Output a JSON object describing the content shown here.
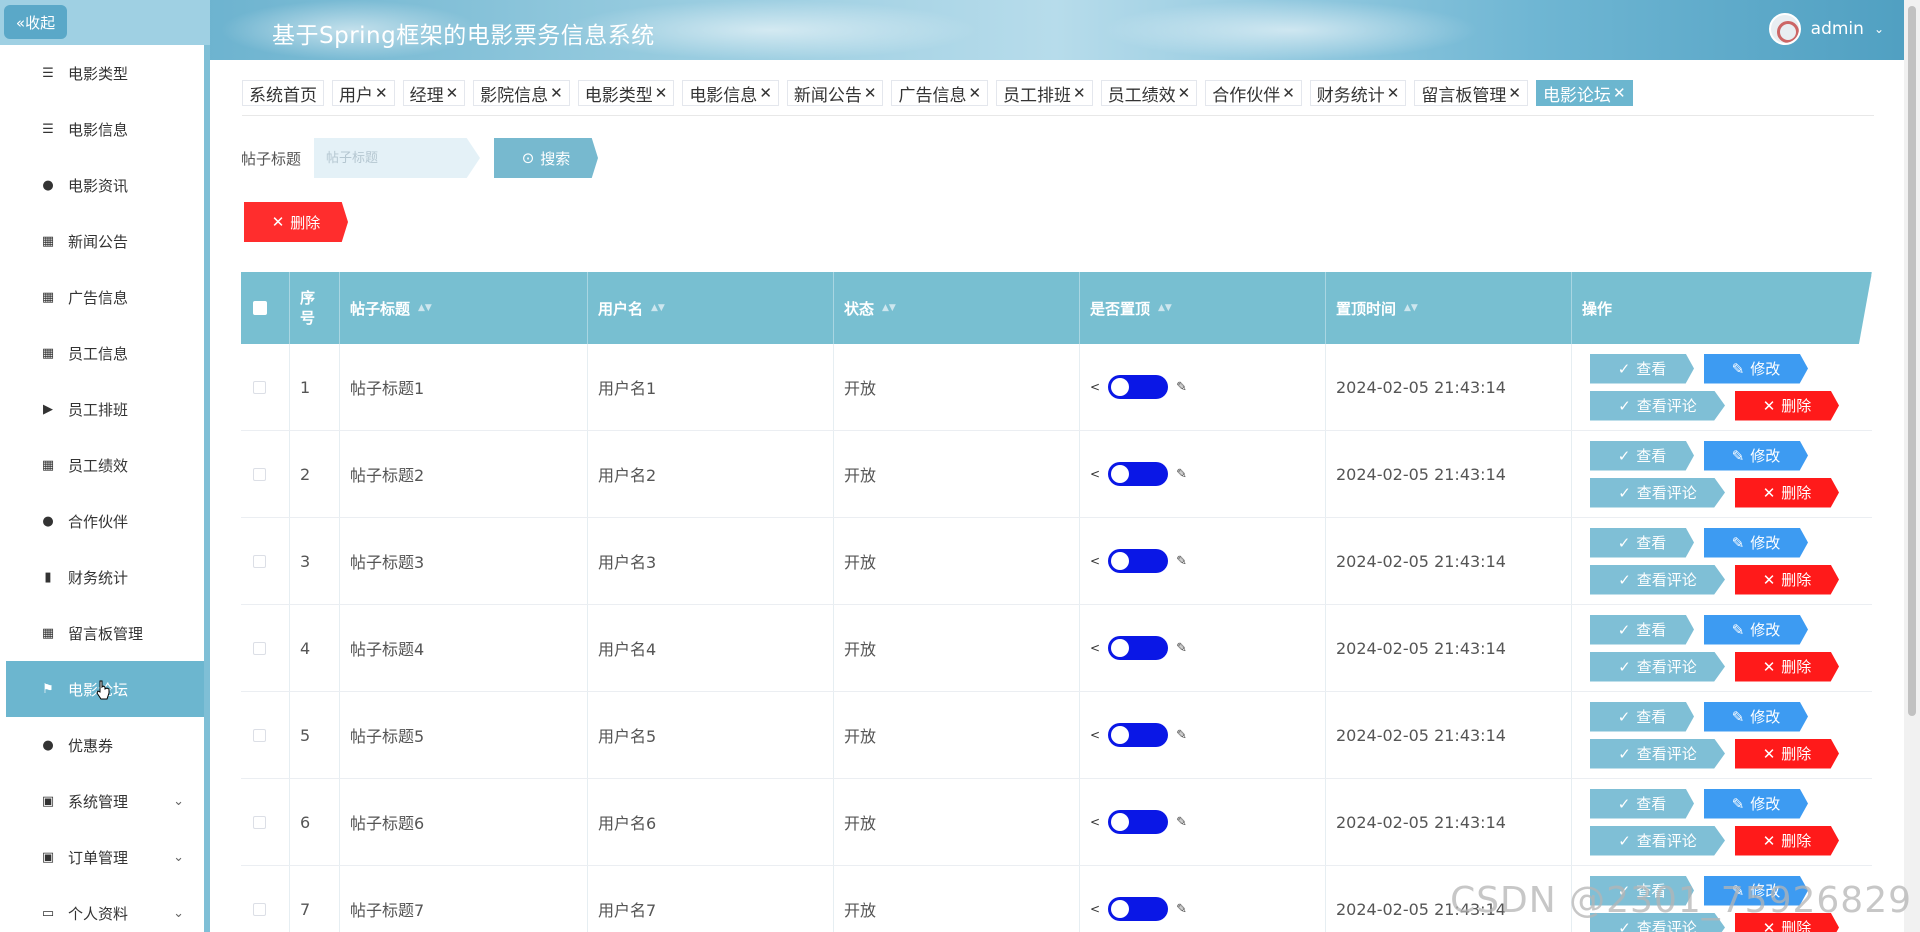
{
  "header": {
    "collapse_label": "«收起",
    "app_title": "基于Spring框架的电影票务信息系统",
    "username": "admin",
    "user_menu_icon": "chevron-down-icon"
  },
  "sidebar": {
    "items": [
      {
        "label": "电影类型",
        "icon": "list-icon",
        "glyph": "☰"
      },
      {
        "label": "电影信息",
        "icon": "list-icon",
        "glyph": "☰"
      },
      {
        "label": "电影资讯",
        "icon": "bulb-icon",
        "glyph": "●"
      },
      {
        "label": "新闻公告",
        "icon": "grid-icon",
        "glyph": "▦"
      },
      {
        "label": "广告信息",
        "icon": "grid-icon",
        "glyph": "▦"
      },
      {
        "label": "员工信息",
        "icon": "grid-icon",
        "glyph": "▦"
      },
      {
        "label": "员工排班",
        "icon": "video-icon",
        "glyph": "▶"
      },
      {
        "label": "员工绩效",
        "icon": "grid-icon",
        "glyph": "▦"
      },
      {
        "label": "合作伙伴",
        "icon": "user-icon",
        "glyph": "●"
      },
      {
        "label": "财务统计",
        "icon": "bar-chart-icon",
        "glyph": "▮"
      },
      {
        "label": "留言板管理",
        "icon": "grid-icon",
        "glyph": "▦"
      },
      {
        "label": "电影论坛",
        "icon": "flag-icon",
        "glyph": "⚑",
        "active": true
      },
      {
        "label": "优惠券",
        "icon": "user-icon",
        "glyph": "●"
      },
      {
        "label": "系统管理",
        "icon": "chart-icon",
        "glyph": "▣",
        "expandable": true
      },
      {
        "label": "订单管理",
        "icon": "clipboard-icon",
        "glyph": "▣",
        "expandable": true
      },
      {
        "label": "个人资料",
        "icon": "card-icon",
        "glyph": "▭",
        "expandable": true
      }
    ]
  },
  "tags": [
    {
      "label": "系统首页",
      "closable": false
    },
    {
      "label": "用户",
      "closable": true
    },
    {
      "label": "经理",
      "closable": true
    },
    {
      "label": "影院信息",
      "closable": true
    },
    {
      "label": "电影类型",
      "closable": true
    },
    {
      "label": "电影信息",
      "closable": true
    },
    {
      "label": "新闻公告",
      "closable": true
    },
    {
      "label": "广告信息",
      "closable": true
    },
    {
      "label": "员工排班",
      "closable": true
    },
    {
      "label": "员工绩效",
      "closable": true
    },
    {
      "label": "合作伙伴",
      "closable": true
    },
    {
      "label": "财务统计",
      "closable": true
    },
    {
      "label": "留言板管理",
      "closable": true
    },
    {
      "label": "电影论坛",
      "closable": true,
      "active": true
    }
  ],
  "search": {
    "label": "帖子标题",
    "placeholder": "帖子标题",
    "button_label": "搜索"
  },
  "toolbar": {
    "delete_label": "删除"
  },
  "table": {
    "headers": [
      "序号",
      "帖子标题",
      "用户名",
      "状态",
      "是否置顶",
      "置顶时间",
      "操作"
    ],
    "rows": [
      {
        "index": "1",
        "title": "帖子标题1",
        "user": "用户名1",
        "status": "开放",
        "pinned": true,
        "pin_time": "2024-02-05 21:43:14"
      },
      {
        "index": "2",
        "title": "帖子标题2",
        "user": "用户名2",
        "status": "开放",
        "pinned": true,
        "pin_time": "2024-02-05 21:43:14"
      },
      {
        "index": "3",
        "title": "帖子标题3",
        "user": "用户名3",
        "status": "开放",
        "pinned": true,
        "pin_time": "2024-02-05 21:43:14"
      },
      {
        "index": "4",
        "title": "帖子标题4",
        "user": "用户名4",
        "status": "开放",
        "pinned": true,
        "pin_time": "2024-02-05 21:43:14"
      },
      {
        "index": "5",
        "title": "帖子标题5",
        "user": "用户名5",
        "status": "开放",
        "pinned": true,
        "pin_time": "2024-02-05 21:43:14"
      },
      {
        "index": "6",
        "title": "帖子标题6",
        "user": "用户名6",
        "status": "开放",
        "pinned": true,
        "pin_time": "2024-02-05 21:43:14"
      },
      {
        "index": "7",
        "title": "帖子标题7",
        "user": "用户名7",
        "status": "开放",
        "pinned": true,
        "pin_time": "2024-02-05 21:43:14"
      }
    ],
    "actions": {
      "view": "查看",
      "edit": "修改",
      "comments": "查看评论",
      "remove": "删除"
    }
  },
  "watermark": "CSDN @2301_75926829",
  "colors": {
    "accent": "#6cb6cf",
    "danger": "#ff1a1a",
    "edit": "#3d9bf2",
    "switch_on": "#0a17e6"
  }
}
